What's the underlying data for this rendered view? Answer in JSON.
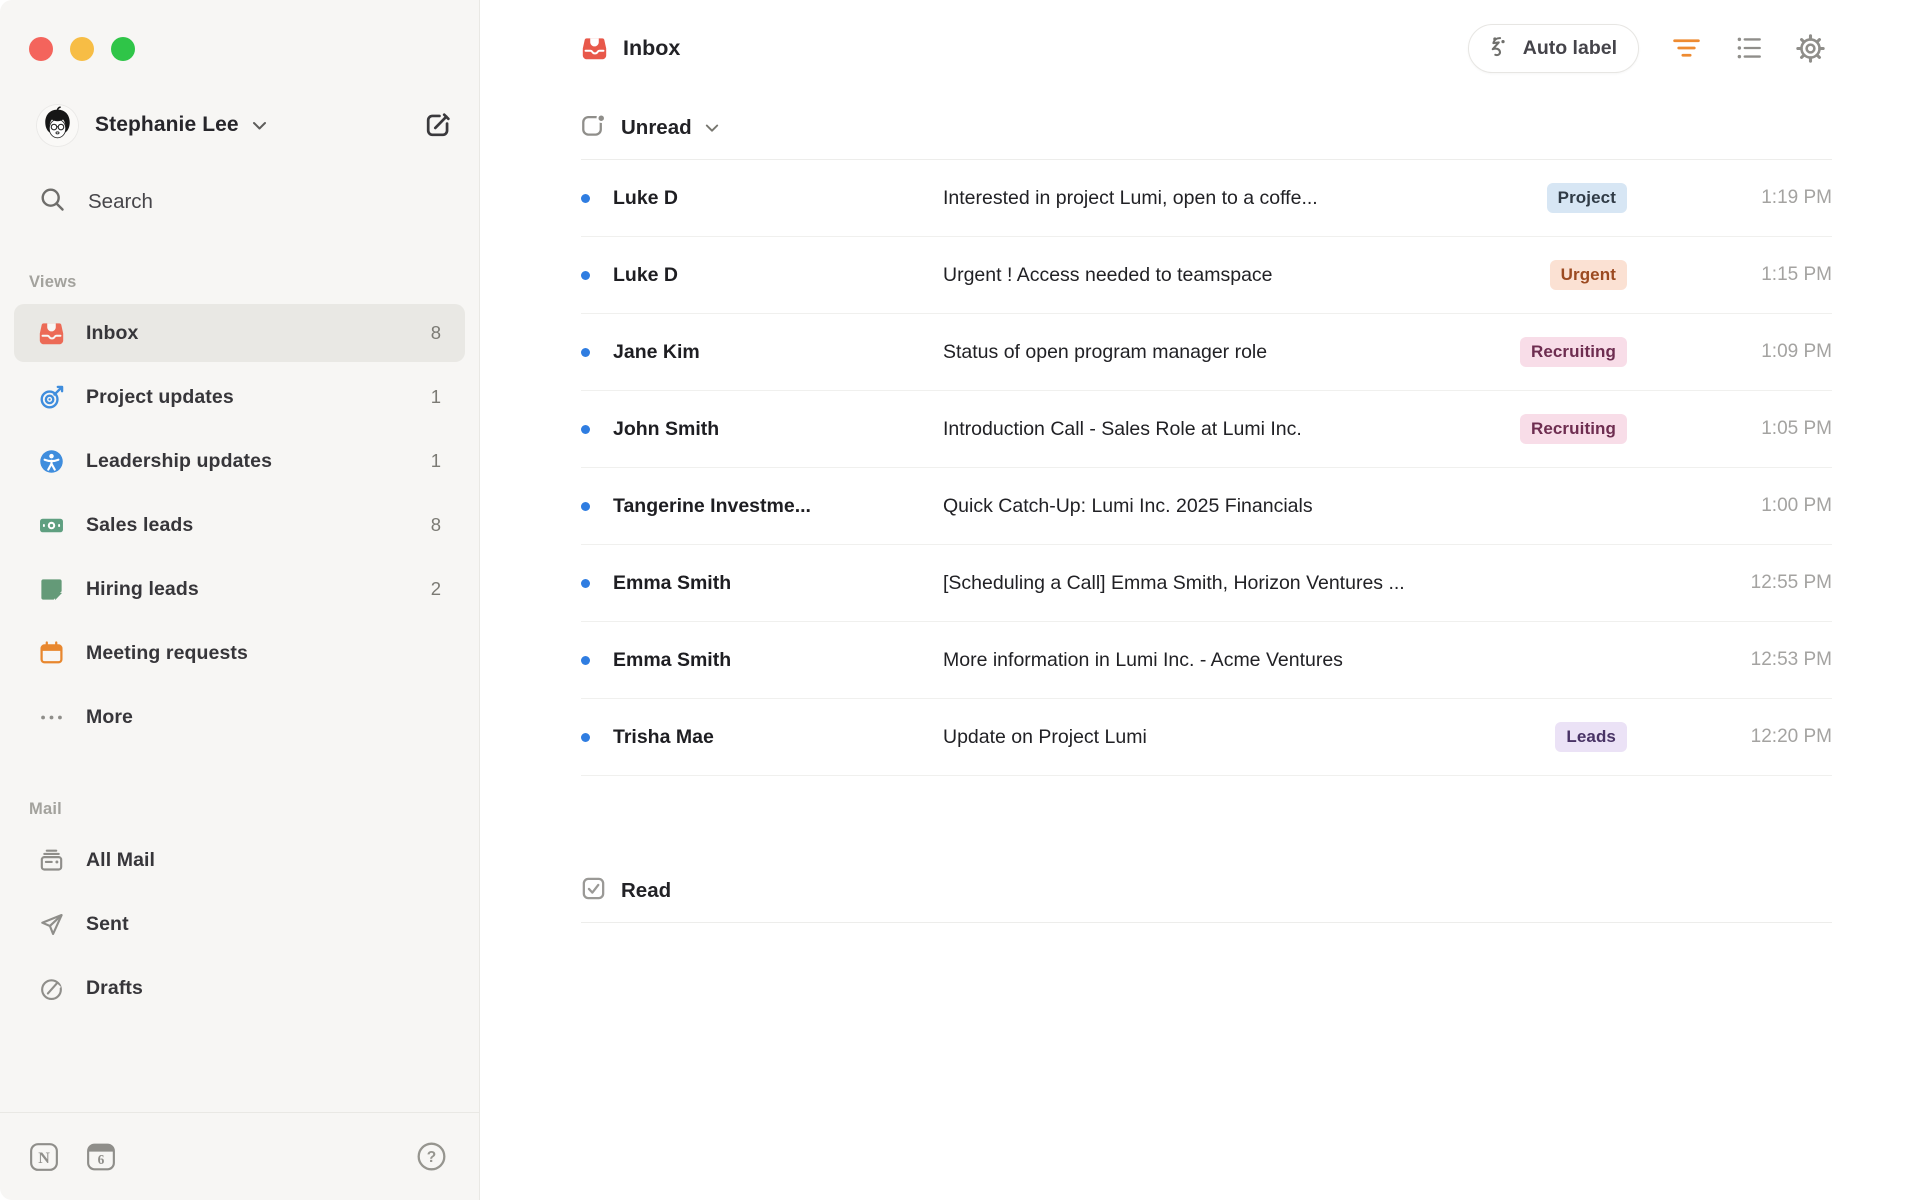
{
  "account": {
    "name": "Stephanie Lee"
  },
  "sidebar": {
    "search_label": "Search",
    "views_label": "Views",
    "views": [
      {
        "label": "Inbox",
        "count": "8",
        "icon": "inbox-tray-icon",
        "selected": true
      },
      {
        "label": "Project updates",
        "count": "1",
        "icon": "target-icon",
        "selected": false
      },
      {
        "label": "Leadership updates",
        "count": "1",
        "icon": "person-circle-icon",
        "selected": false
      },
      {
        "label": "Sales leads",
        "count": "8",
        "icon": "banknote-icon",
        "selected": false
      },
      {
        "label": "Hiring leads",
        "count": "2",
        "icon": "note-icon",
        "selected": false
      },
      {
        "label": "Meeting requests",
        "count": "",
        "icon": "calendar-icon",
        "selected": false
      },
      {
        "label": "More",
        "count": "",
        "icon": "ellipsis-icon",
        "selected": false
      }
    ],
    "mail_label": "Mail",
    "mail": [
      {
        "label": "All Mail",
        "icon": "all-mail-icon"
      },
      {
        "label": "Sent",
        "icon": "paper-plane-icon"
      },
      {
        "label": "Drafts",
        "icon": "draft-pencil-icon"
      }
    ],
    "footer": {
      "notion_logo": "N",
      "calendar_day": "6",
      "help": "?"
    }
  },
  "header": {
    "title": "Inbox",
    "auto_label": "Auto label"
  },
  "groups": {
    "unread": "Unread",
    "read": "Read"
  },
  "emails": [
    {
      "sender": "Luke D",
      "subject": "Interested in project Lumi, open to a coffe...",
      "label": "Project",
      "label_color": "blue",
      "time": "1:19 PM"
    },
    {
      "sender": "Luke D",
      "subject": "Urgent ! Access needed to teamspace",
      "label": "Urgent",
      "label_color": "orange",
      "time": "1:15 PM"
    },
    {
      "sender": "Jane Kim",
      "subject": "Status of open program manager role",
      "label": "Recruiting",
      "label_color": "pink",
      "time": "1:09 PM"
    },
    {
      "sender": "John Smith",
      "subject": "Introduction Call - Sales Role at Lumi Inc.",
      "label": "Recruiting",
      "label_color": "pink",
      "time": "1:05 PM"
    },
    {
      "sender": "Tangerine Investme...",
      "subject": "Quick Catch-Up: Lumi Inc. 2025 Financials",
      "label": "",
      "label_color": "",
      "time": "1:00 PM"
    },
    {
      "sender": "Emma Smith",
      "subject": "[Scheduling a Call] Emma Smith, Horizon Ventures ...",
      "label": "",
      "label_color": "",
      "time": "12:55 PM"
    },
    {
      "sender": "Emma Smith",
      "subject": "More information in Lumi Inc. - Acme Ventures",
      "label": "",
      "label_color": "",
      "time": "12:53 PM"
    },
    {
      "sender": "Trisha Mae",
      "subject": "Update on Project Lumi",
      "label": "Leads",
      "label_color": "purple",
      "time": "12:20 PM"
    }
  ],
  "colors": {
    "unread_dot": "#2f7de1",
    "inbox_icon_red": "#e8584a",
    "filter_icon_orange": "#ee8b31",
    "badge_blue_bg": "#d7e6f4",
    "badge_orange_bg": "#fbe1d3",
    "badge_pink_bg": "#f8dde8",
    "badge_purple_bg": "#ebe2f6",
    "sidebar_bg": "#f7f6f4",
    "selected_item_bg": "#e9e8e4"
  }
}
